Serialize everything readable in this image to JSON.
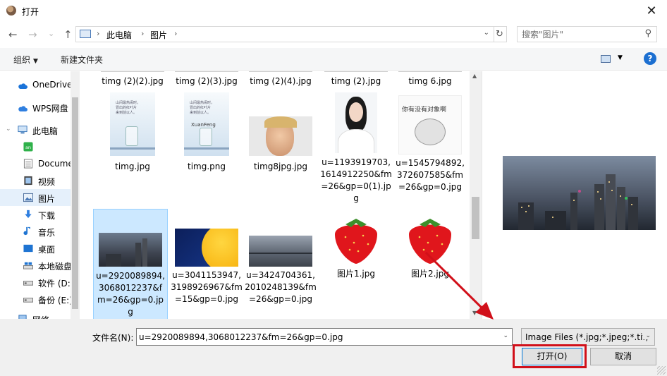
{
  "window": {
    "title": "打开",
    "close_glyph": "✕"
  },
  "nav": {
    "back": "←",
    "forward": "→",
    "recent": "⌄",
    "up": "↑"
  },
  "address": {
    "crumbs": [
      "此电脑",
      "图片"
    ],
    "separator": "›",
    "drop": "⌄",
    "refresh": "↻"
  },
  "search": {
    "placeholder": "搜索\"图片\"",
    "icon": "⚲"
  },
  "toolbar": {
    "organize": "组织",
    "organize_caret": "▼",
    "new_folder": "新建文件夹",
    "view_caret": "▼",
    "help": "?"
  },
  "sidebar": {
    "items": [
      {
        "label": "OneDrive",
        "icon": "cloud-icon"
      },
      {
        "label": "WPS网盘",
        "icon": "cloud-icon"
      },
      {
        "label": "此电脑",
        "icon": "computer-icon"
      },
      {
        "label": "",
        "icon": "wechat-icon"
      },
      {
        "label": "Docume",
        "icon": "document-icon"
      },
      {
        "label": "视频",
        "icon": "video-icon"
      },
      {
        "label": "图片",
        "icon": "picture-icon"
      },
      {
        "label": "下载",
        "icon": "download-icon"
      },
      {
        "label": "音乐",
        "icon": "music-icon"
      },
      {
        "label": "桌面",
        "icon": "desktop-icon"
      },
      {
        "label": "本地磁盘",
        "icon": "drive-icon"
      },
      {
        "label": "软件 (D:",
        "icon": "drive-icon"
      },
      {
        "label": "备份 (E:)",
        "icon": "drive-icon"
      },
      {
        "label": "网络",
        "icon": "network-icon"
      }
    ]
  },
  "files": {
    "row0": [
      "timg (2)(2).jpg",
      "timg (2)(3).jpg",
      "timg (2)(4).jpg",
      "timg (2).jpg",
      "timg 6.jpg"
    ],
    "row1": [
      "timg.jpg",
      "timg.png",
      "timg8jpg.jpg",
      "u=1193919703,1614912250&fm=26&gp=0(1).jpg",
      "u=1545794892,372607585&fm=26&gp=0.jpg"
    ],
    "row2": [
      "u=2920089894,3068012237&fm=26&gp=0.jpg",
      "u=3041153947,3198926967&fm=15&gp=0.jpg",
      "u=3424704361,2010248139&fm=26&gp=0.jpg",
      "图片1.jpg",
      "图片2.jpg"
    ],
    "thumb_text": {
      "poster_line1": "山间最热闹时，",
      "poster_line2": "冒出的红叶片",
      "poster_line3": "来到前以人。",
      "xuanfeng": "XuanFeng",
      "meme": "你有没有对象啊"
    }
  },
  "scroll": {
    "up": "▲",
    "down": "▼"
  },
  "bottom": {
    "filename_label": "文件名(N):",
    "filename_value": "u=2920089894,3068012237&fm=26&gp=0.jpg",
    "filetype": "Image Files (*.jpg;*.jpeg;*.tif;",
    "drop": "⌄",
    "open": "打开(O)",
    "cancel": "取消"
  },
  "colors": {
    "selection": "#cce8ff",
    "highlight": "#d1101a",
    "accent": "#0078d7"
  }
}
